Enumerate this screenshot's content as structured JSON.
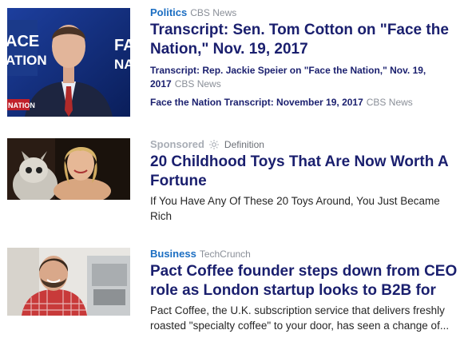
{
  "articles": [
    {
      "category": "Politics",
      "source": "CBS News",
      "title": "Transcript: Sen. Tom Cotton on \"Face the Nation,\" Nov. 19, 2017",
      "thumb_texts": [
        "ACE",
        "ATION",
        "FA",
        "NAT",
        "NATION"
      ],
      "related": [
        {
          "title": "Transcript: Rep. Jackie Speier on \"Face the Nation,\" Nov. 19, 2017",
          "source": "CBS News"
        },
        {
          "title": "Face the Nation Transcript: November 19, 2017",
          "source": "CBS News"
        }
      ]
    },
    {
      "label": "Sponsored",
      "source": "Definition",
      "title": "20 Childhood Toys That Are Now Worth A Fortune",
      "summary": "If You Have Any Of These 20 Toys Around, You Just Became Rich"
    },
    {
      "category": "Business",
      "source": "TechCrunch",
      "title": "Pact Coffee founder steps down from CEO role as London startup looks to B2B for",
      "summary": "Pact Coffee, the U.K. subscription service that delivers freshly roasted \"specialty coffee\" to your door, has seen a change of..."
    }
  ],
  "colors": {
    "category": "#1b6ec2",
    "headline": "#1a1f6e",
    "source": "#8a8f98"
  }
}
